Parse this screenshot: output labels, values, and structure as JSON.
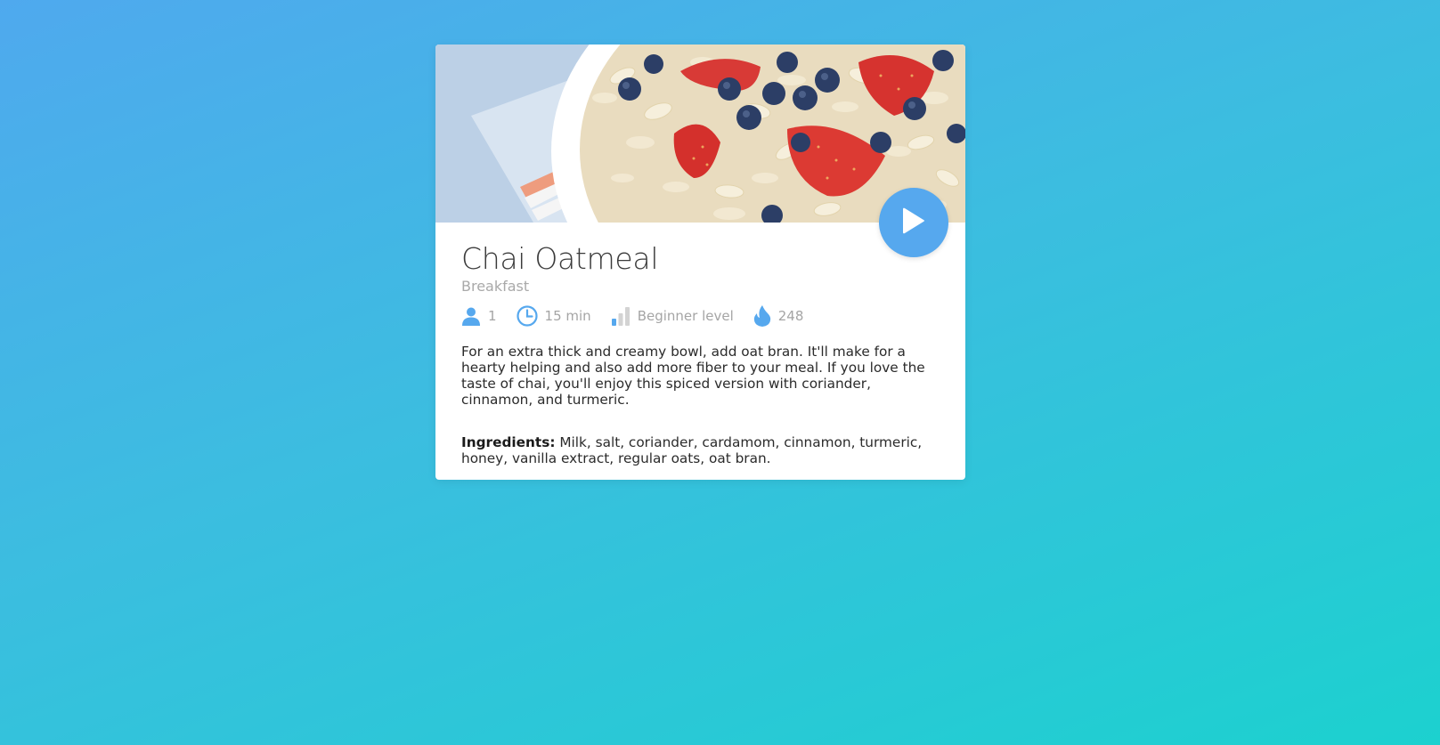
{
  "recipe": {
    "title": "Chai Oatmeal",
    "category": "Breakfast",
    "servings": "1",
    "time": "15 min",
    "level": "Beginner level",
    "calories": "248",
    "description": "For an extra thick and creamy bowl, add oat bran. It'll make for a hearty helping and also add more fiber to your meal. If you love the taste of chai, you'll enjoy this spiced version with coriander, cinnamon, and turmeric.",
    "ingredients_label": "Ingredients:",
    "ingredients": " Milk, salt, coriander, cardamom, cinnamon, turmeric, honey, vanilla extract, regular oats, oat bran."
  },
  "icons": {
    "play": "play-icon",
    "servings": "user-icon",
    "time": "clock-icon",
    "level": "signal-bars-icon",
    "calories": "flame-icon"
  },
  "colors": {
    "accent": "#56a8ee",
    "background_start": "#4fa9ee",
    "background_end": "#1cd1cf",
    "muted_text": "#a5a5a5"
  }
}
